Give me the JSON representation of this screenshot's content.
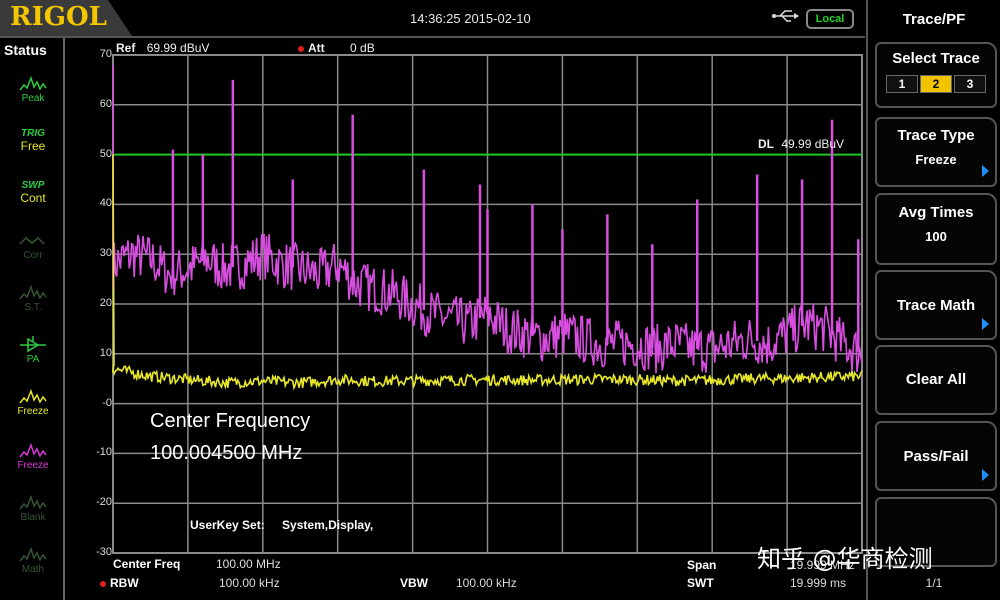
{
  "header": {
    "logo": "RIGOL",
    "datetime": "14:36:25 2015-02-10",
    "usb_icon": "usb-icon",
    "remote_status": "Local"
  },
  "status": {
    "title": "Status",
    "items": [
      {
        "icon": "peak-icon",
        "line1": "",
        "line2": "Peak",
        "color": "#2ecc40"
      },
      {
        "icon": "",
        "line1": "TRIG",
        "line2": "Free",
        "color1": "#2ecc40",
        "color2": "#e6e62a"
      },
      {
        "icon": "",
        "line1": "SWP",
        "line2": "Cont",
        "color1": "#2ecc40",
        "color2": "#e6e62a"
      },
      {
        "icon": "correction-icon",
        "line1": "",
        "line2": "Corr",
        "color": "#355535"
      },
      {
        "icon": "signal-track-icon",
        "line1": "",
        "line2": "S.T.",
        "color": "#355535"
      },
      {
        "icon": "preamp-icon",
        "line1": "",
        "line2": "PA",
        "color": "#2ecc40"
      },
      {
        "icon": "trace1-icon",
        "line1": "",
        "line2": "Freeze",
        "color": "#e6e62a"
      },
      {
        "icon": "trace2-icon",
        "line1": "",
        "line2": "Freeze",
        "color": "#d838d8"
      },
      {
        "icon": "trace3-icon",
        "line1": "",
        "line2": "Blank",
        "color": "#355535"
      },
      {
        "icon": "math-icon",
        "line1": "",
        "line2": "Math",
        "color": "#355535"
      }
    ]
  },
  "plot": {
    "ref_label": "Ref",
    "ref_value": "69.99 dBuV",
    "att_label": "Att",
    "att_value": "0 dB",
    "dl_label": "DL",
    "dl_value": "49.99 dBuV",
    "overlay_title": "Center Frequency",
    "overlay_value": "100.004500 MHz",
    "userkey_label": "UserKey Set:",
    "userkey_value": "System,Display,"
  },
  "bottom": {
    "center_freq_label": "Center Freq",
    "center_freq_value": "100.00 MHz",
    "rbw_label": "RBW",
    "rbw_value": "100.00 kHz",
    "vbw_label": "VBW",
    "vbw_value": "100.00 kHz",
    "span_label": "Span",
    "span_value": "19.999 MHz",
    "swt_label": "SWT",
    "swt_value": "19.999 ms"
  },
  "menu": {
    "title": "Trace/PF",
    "select_trace_label": "Select Trace",
    "traces": [
      "1",
      "2",
      "3"
    ],
    "selected_trace": "2",
    "trace_type_label": "Trace Type",
    "trace_type_value": "Freeze",
    "avg_times_label": "Avg Times",
    "avg_times_value": "100",
    "trace_math_label": "Trace Math",
    "clear_all_label": "Clear All",
    "pass_fail_label": "Pass/Fail",
    "page": "1/1"
  },
  "watermark": "知乎 @华商检测",
  "chart_data": {
    "type": "line",
    "title": "",
    "ylabel": "dBuV",
    "xlabel": "",
    "ylim": [
      -30,
      70
    ],
    "yticks": [
      "70",
      "60",
      "50",
      "40",
      "30",
      "20",
      "10",
      "-0",
      "-10",
      "-20",
      "-30"
    ],
    "x_divisions": 10,
    "grid": true,
    "display_line": 49.99,
    "colors": {
      "trace1": "#e8e82a",
      "trace2": "#d84ee0",
      "display_line": "#1ec81e",
      "grid": "#8a8a8a"
    },
    "series": [
      {
        "name": "Trace 1 (Freeze, yellow)",
        "x_div": [
          0,
          0.5,
          1,
          1.5,
          2,
          2.5,
          3,
          3.5,
          4,
          4.5,
          5,
          5.5,
          6,
          6.5,
          7,
          7.5,
          8,
          8.5,
          9,
          9.5,
          10
        ],
        "values": [
          7,
          5.5,
          4.8,
          4.2,
          4.5,
          4.2,
          4.8,
          4.5,
          4.6,
          4.7,
          4.8,
          4.7,
          4.8,
          4.9,
          4.8,
          4.6,
          4.7,
          5.0,
          5.1,
          5.3,
          5.5
        ]
      },
      {
        "name": "Trace 2 (Freeze, magenta)",
        "x_div": [
          0,
          0.25,
          0.5,
          0.75,
          1,
          1.25,
          1.5,
          1.75,
          2,
          2.25,
          2.5,
          2.75,
          3,
          3.25,
          3.5,
          3.75,
          4,
          4.25,
          4.5,
          4.75,
          5,
          5.25,
          5.5,
          5.75,
          6,
          6.25,
          6.5,
          6.75,
          7,
          7.25,
          7.5,
          7.75,
          8,
          8.25,
          8.5,
          8.75,
          9,
          9.25,
          9.5,
          9.75,
          10
        ],
        "values": [
          28,
          30,
          29,
          26,
          27,
          29,
          27,
          28,
          30,
          28,
          27,
          26,
          28,
          24,
          23,
          22,
          20,
          18,
          17,
          16,
          18,
          15,
          14,
          13,
          14,
          13,
          12,
          12,
          12,
          11,
          12,
          11,
          11,
          12,
          13,
          12,
          14,
          16,
          15,
          12,
          10
        ]
      }
    ],
    "spurs": [
      {
        "x_div": 0.8,
        "value": 51
      },
      {
        "x_div": 1.2,
        "value": 50
      },
      {
        "x_div": 1.6,
        "value": 65
      },
      {
        "x_div": 2.4,
        "value": 45
      },
      {
        "x_div": 3.2,
        "value": 58
      },
      {
        "x_div": 4.15,
        "value": 47
      },
      {
        "x_div": 4.9,
        "value": 44
      },
      {
        "x_div": 5.0,
        "value": 39
      },
      {
        "x_div": 5.6,
        "value": 40
      },
      {
        "x_div": 6.0,
        "value": 35
      },
      {
        "x_div": 6.6,
        "value": 38
      },
      {
        "x_div": 7.2,
        "value": 32
      },
      {
        "x_div": 7.8,
        "value": 41
      },
      {
        "x_div": 8.6,
        "value": 46
      },
      {
        "x_div": 9.2,
        "value": 45
      },
      {
        "x_div": 9.6,
        "value": 57
      },
      {
        "x_div": 9.95,
        "value": 33
      }
    ]
  }
}
